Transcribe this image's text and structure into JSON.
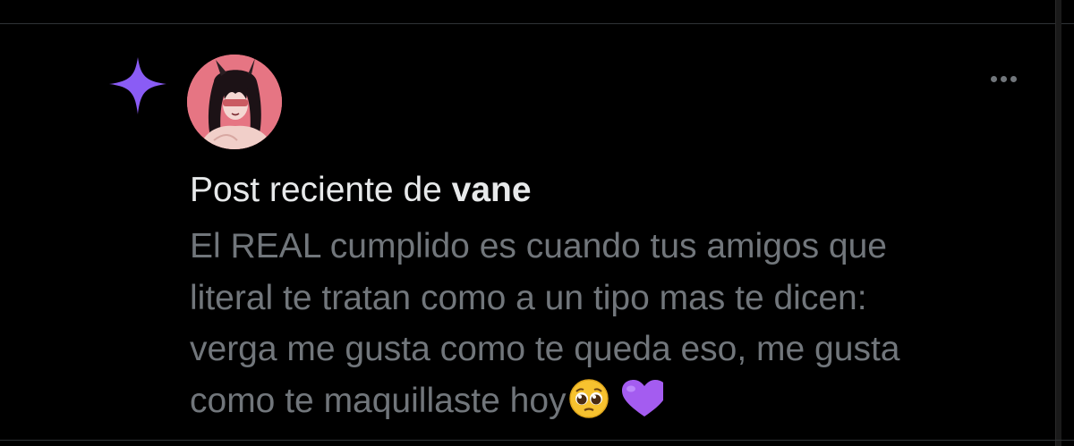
{
  "notification": {
    "icon": "sparkle-icon",
    "accent_color": "#8a5cf5",
    "avatar": "user-avatar",
    "header_prefix": "Post reciente de ",
    "author_name": "vane",
    "body_lines": [
      "El REAL cumplido es cuando tus amigos que",
      "literal te tratan como a un tipo mas te dicen:",
      "verga me gusta como te queda eso, me gusta",
      "como te maquillaste hoy"
    ],
    "emojis": [
      "pleading-face-emoji",
      "purple-heart-emoji"
    ],
    "more_icon": "more-options-icon"
  },
  "colors": {
    "background": "#000000",
    "primary_text": "#e7e9ea",
    "secondary_text": "#71767b",
    "divider": "#2f3336"
  }
}
